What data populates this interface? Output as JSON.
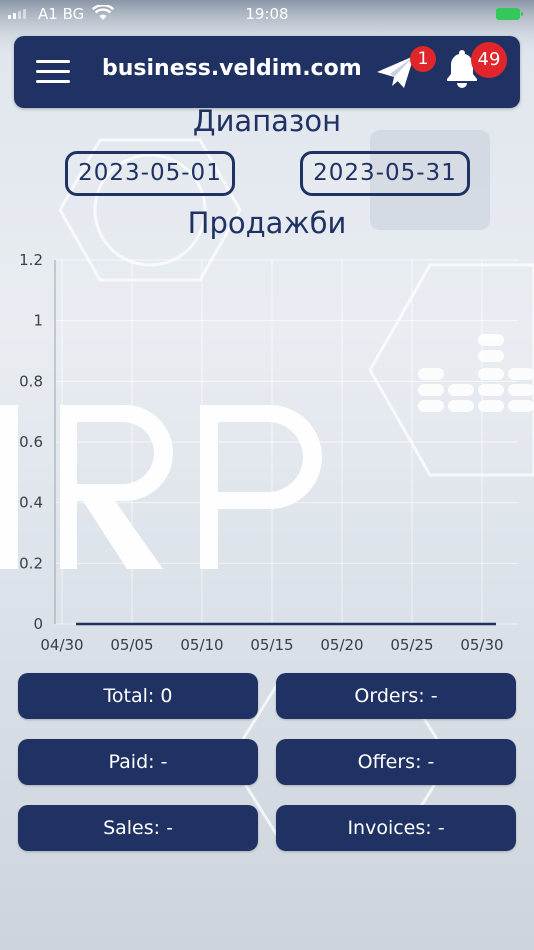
{
  "status_bar": {
    "carrier": "A1 BG",
    "time": "19:08"
  },
  "header": {
    "title": "business.veldim.com",
    "messages_badge": "1",
    "notifications_badge": "49"
  },
  "range": {
    "title": "Диапазон",
    "date_from": "2023-05-01",
    "date_to": "2023-05-31"
  },
  "chart_title": "Продажби",
  "chart_data": {
    "type": "line",
    "title": "Продажби",
    "x_ticks": [
      "04/30",
      "05/05",
      "05/10",
      "05/15",
      "05/20",
      "05/25",
      "05/30"
    ],
    "y_ticks": [
      "0",
      "0.2",
      "0.4",
      "0.6",
      "0.8",
      "1",
      "1.2"
    ],
    "ylim": [
      0,
      1.2
    ],
    "grid": true,
    "series": [
      {
        "color": "#1f3263",
        "x": [
          "05/01",
          "05/31"
        ],
        "values": [
          0,
          0
        ]
      }
    ]
  },
  "stats": {
    "total": "Total: 0",
    "orders": "Orders: -",
    "paid": "Paid: -",
    "offers": "Offers: -",
    "sales": "Sales: -",
    "invoices": "Invoices: -"
  },
  "colors": {
    "primary": "#1f3263",
    "badge": "#e0252b"
  },
  "icons": {
    "menu": "hamburger-icon",
    "messages": "paper-plane-icon",
    "notifications": "bell-icon"
  }
}
